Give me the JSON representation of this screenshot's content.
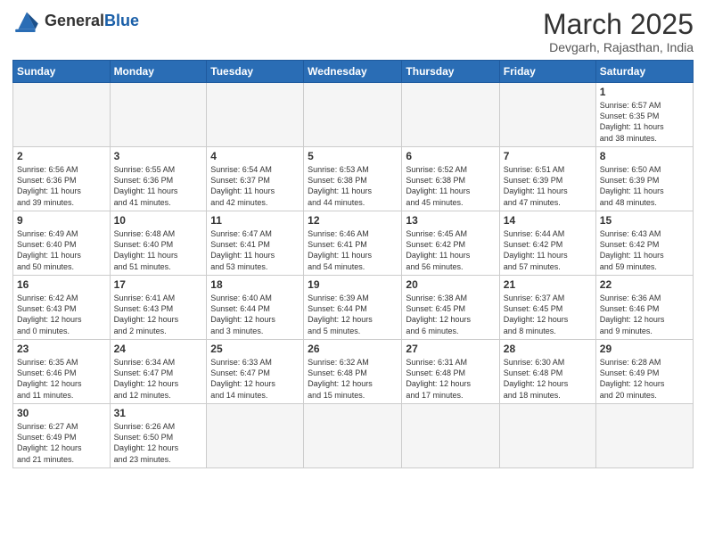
{
  "header": {
    "logo_general": "General",
    "logo_blue": "Blue",
    "main_title": "March 2025",
    "subtitle": "Devgarh, Rajasthan, India"
  },
  "days_of_week": [
    "Sunday",
    "Monday",
    "Tuesday",
    "Wednesday",
    "Thursday",
    "Friday",
    "Saturday"
  ],
  "weeks": [
    [
      {
        "day": "",
        "info": ""
      },
      {
        "day": "",
        "info": ""
      },
      {
        "day": "",
        "info": ""
      },
      {
        "day": "",
        "info": ""
      },
      {
        "day": "",
        "info": ""
      },
      {
        "day": "",
        "info": ""
      },
      {
        "day": "1",
        "info": "Sunrise: 6:57 AM\nSunset: 6:35 PM\nDaylight: 11 hours\nand 38 minutes."
      }
    ],
    [
      {
        "day": "2",
        "info": "Sunrise: 6:56 AM\nSunset: 6:36 PM\nDaylight: 11 hours\nand 39 minutes."
      },
      {
        "day": "3",
        "info": "Sunrise: 6:55 AM\nSunset: 6:36 PM\nDaylight: 11 hours\nand 41 minutes."
      },
      {
        "day": "4",
        "info": "Sunrise: 6:54 AM\nSunset: 6:37 PM\nDaylight: 11 hours\nand 42 minutes."
      },
      {
        "day": "5",
        "info": "Sunrise: 6:53 AM\nSunset: 6:38 PM\nDaylight: 11 hours\nand 44 minutes."
      },
      {
        "day": "6",
        "info": "Sunrise: 6:52 AM\nSunset: 6:38 PM\nDaylight: 11 hours\nand 45 minutes."
      },
      {
        "day": "7",
        "info": "Sunrise: 6:51 AM\nSunset: 6:39 PM\nDaylight: 11 hours\nand 47 minutes."
      },
      {
        "day": "8",
        "info": "Sunrise: 6:50 AM\nSunset: 6:39 PM\nDaylight: 11 hours\nand 48 minutes."
      }
    ],
    [
      {
        "day": "9",
        "info": "Sunrise: 6:49 AM\nSunset: 6:40 PM\nDaylight: 11 hours\nand 50 minutes."
      },
      {
        "day": "10",
        "info": "Sunrise: 6:48 AM\nSunset: 6:40 PM\nDaylight: 11 hours\nand 51 minutes."
      },
      {
        "day": "11",
        "info": "Sunrise: 6:47 AM\nSunset: 6:41 PM\nDaylight: 11 hours\nand 53 minutes."
      },
      {
        "day": "12",
        "info": "Sunrise: 6:46 AM\nSunset: 6:41 PM\nDaylight: 11 hours\nand 54 minutes."
      },
      {
        "day": "13",
        "info": "Sunrise: 6:45 AM\nSunset: 6:42 PM\nDaylight: 11 hours\nand 56 minutes."
      },
      {
        "day": "14",
        "info": "Sunrise: 6:44 AM\nSunset: 6:42 PM\nDaylight: 11 hours\nand 57 minutes."
      },
      {
        "day": "15",
        "info": "Sunrise: 6:43 AM\nSunset: 6:42 PM\nDaylight: 11 hours\nand 59 minutes."
      }
    ],
    [
      {
        "day": "16",
        "info": "Sunrise: 6:42 AM\nSunset: 6:43 PM\nDaylight: 12 hours\nand 0 minutes."
      },
      {
        "day": "17",
        "info": "Sunrise: 6:41 AM\nSunset: 6:43 PM\nDaylight: 12 hours\nand 2 minutes."
      },
      {
        "day": "18",
        "info": "Sunrise: 6:40 AM\nSunset: 6:44 PM\nDaylight: 12 hours\nand 3 minutes."
      },
      {
        "day": "19",
        "info": "Sunrise: 6:39 AM\nSunset: 6:44 PM\nDaylight: 12 hours\nand 5 minutes."
      },
      {
        "day": "20",
        "info": "Sunrise: 6:38 AM\nSunset: 6:45 PM\nDaylight: 12 hours\nand 6 minutes."
      },
      {
        "day": "21",
        "info": "Sunrise: 6:37 AM\nSunset: 6:45 PM\nDaylight: 12 hours\nand 8 minutes."
      },
      {
        "day": "22",
        "info": "Sunrise: 6:36 AM\nSunset: 6:46 PM\nDaylight: 12 hours\nand 9 minutes."
      }
    ],
    [
      {
        "day": "23",
        "info": "Sunrise: 6:35 AM\nSunset: 6:46 PM\nDaylight: 12 hours\nand 11 minutes."
      },
      {
        "day": "24",
        "info": "Sunrise: 6:34 AM\nSunset: 6:47 PM\nDaylight: 12 hours\nand 12 minutes."
      },
      {
        "day": "25",
        "info": "Sunrise: 6:33 AM\nSunset: 6:47 PM\nDaylight: 12 hours\nand 14 minutes."
      },
      {
        "day": "26",
        "info": "Sunrise: 6:32 AM\nSunset: 6:48 PM\nDaylight: 12 hours\nand 15 minutes."
      },
      {
        "day": "27",
        "info": "Sunrise: 6:31 AM\nSunset: 6:48 PM\nDaylight: 12 hours\nand 17 minutes."
      },
      {
        "day": "28",
        "info": "Sunrise: 6:30 AM\nSunset: 6:48 PM\nDaylight: 12 hours\nand 18 minutes."
      },
      {
        "day": "29",
        "info": "Sunrise: 6:28 AM\nSunset: 6:49 PM\nDaylight: 12 hours\nand 20 minutes."
      }
    ],
    [
      {
        "day": "30",
        "info": "Sunrise: 6:27 AM\nSunset: 6:49 PM\nDaylight: 12 hours\nand 21 minutes."
      },
      {
        "day": "31",
        "info": "Sunrise: 6:26 AM\nSunset: 6:50 PM\nDaylight: 12 hours\nand 23 minutes."
      },
      {
        "day": "",
        "info": ""
      },
      {
        "day": "",
        "info": ""
      },
      {
        "day": "",
        "info": ""
      },
      {
        "day": "",
        "info": ""
      },
      {
        "day": "",
        "info": ""
      }
    ]
  ],
  "colors": {
    "header_bg": "#2a6db5",
    "header_text": "#ffffff",
    "border": "#cccccc",
    "empty_cell": "#f5f5f5"
  }
}
